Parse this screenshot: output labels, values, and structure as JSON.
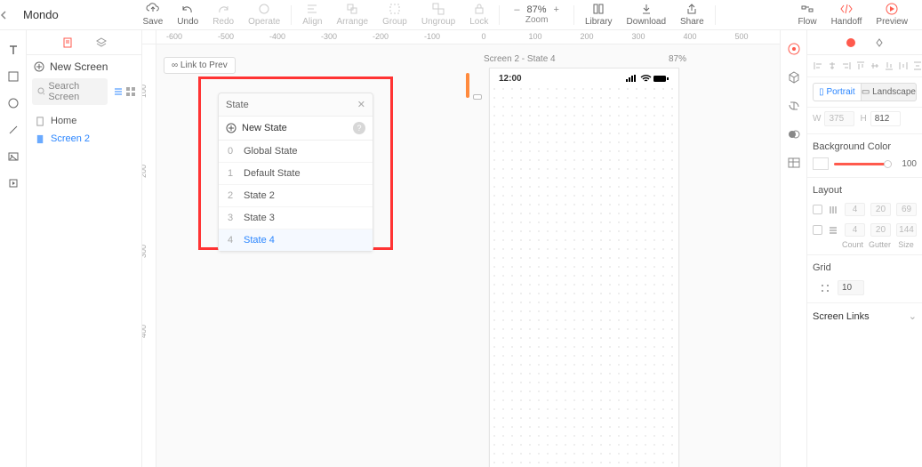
{
  "project_name": "Mondo",
  "toolbar": {
    "save": "Save",
    "undo": "Undo",
    "redo": "Redo",
    "operate": "Operate",
    "align": "Align",
    "arrange": "Arrange",
    "group": "Group",
    "ungroup": "Ungroup",
    "lock": "Lock",
    "zoom_minus": "–",
    "zoom_value": "87%",
    "zoom_plus": "+",
    "zoom_label": "Zoom",
    "library": "Library",
    "download": "Download",
    "share": "Share",
    "flow": "Flow",
    "handoff": "Handoff",
    "preview": "Preview"
  },
  "left": {
    "new_screen": "New Screen",
    "search_placeholder": "Search Screen",
    "items": [
      {
        "label": "Home"
      },
      {
        "label": "Screen 2"
      }
    ]
  },
  "canvas": {
    "link_prev": "Link to Prev",
    "top_ticks": [
      "-600",
      "-500",
      "-400",
      "-300",
      "-200",
      "-100",
      "0",
      "100",
      "200",
      "300",
      "400",
      "500"
    ],
    "left_ticks": [
      "100",
      "200",
      "300",
      "400"
    ],
    "artboard_label": "Screen 2 - State 4",
    "artboard_zoom": "87%",
    "status_time": "12:00",
    "state_panel": {
      "title": "State",
      "new": "New State",
      "items": [
        {
          "idx": "0",
          "label": "Global State"
        },
        {
          "idx": "1",
          "label": "Default State"
        },
        {
          "idx": "2",
          "label": "State 2"
        },
        {
          "idx": "3",
          "label": "State 3"
        },
        {
          "idx": "4",
          "label": "State 4"
        }
      ]
    }
  },
  "right": {
    "portrait": "Portrait",
    "landscape": "Landscape",
    "w_label": "W",
    "w_value": "375",
    "h_label": "H",
    "h_value": "812",
    "bg_title": "Background Color",
    "bg_value": "100",
    "layout_title": "Layout",
    "row1": {
      "a": "4",
      "b": "20",
      "c": "69"
    },
    "row2": {
      "a": "4",
      "b": "20",
      "c": "144"
    },
    "col_labels": {
      "a": "Count",
      "b": "Gutter",
      "c": "Size"
    },
    "grid_title": "Grid",
    "grid_value": "10",
    "links_title": "Screen Links"
  }
}
